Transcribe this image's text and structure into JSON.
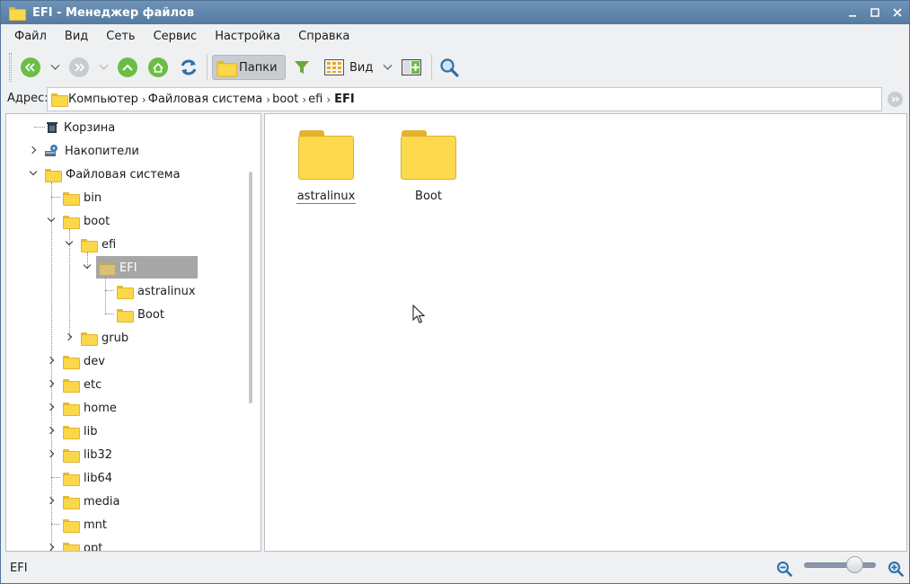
{
  "window": {
    "title": "EFI - Менеджер файлов",
    "minimize": "_",
    "maximize": "□",
    "close": "✕"
  },
  "menu": {
    "items": [
      "Файл",
      "Вид",
      "Сеть",
      "Сервис",
      "Настройка",
      "Справка"
    ]
  },
  "toolbar": {
    "folders_label": "Папки",
    "view_label": "Вид",
    "colors": {
      "nav_green": "#6cbd45",
      "refresh_blue": "#2f6ea6",
      "filter_green": "#6aa83a"
    }
  },
  "address": {
    "label": "Адрес:",
    "crumbs": [
      "Компьютер",
      "Файловая система",
      "boot",
      "efi"
    ],
    "current": "EFI"
  },
  "tree": {
    "items": [
      {
        "label": "Корзина",
        "icon": "trash-icon"
      },
      {
        "label": "Накопители",
        "icon": "drives-icon"
      },
      {
        "label": "Файловая система",
        "icon": "folder-icon"
      },
      {
        "label": "bin"
      },
      {
        "label": "boot"
      },
      {
        "label": "efi"
      },
      {
        "label": "EFI",
        "selected": true
      },
      {
        "label": "astralinux"
      },
      {
        "label": "Boot"
      },
      {
        "label": "grub"
      },
      {
        "label": "dev"
      },
      {
        "label": "etc"
      },
      {
        "label": "home"
      },
      {
        "label": "lib"
      },
      {
        "label": "lib32"
      },
      {
        "label": "lib64"
      },
      {
        "label": "media"
      },
      {
        "label": "mnt"
      },
      {
        "label": "opt"
      }
    ]
  },
  "content": {
    "items": [
      {
        "name": "astralinux",
        "focused": true
      },
      {
        "name": "Boot",
        "focused": false
      }
    ]
  },
  "status": {
    "text": "EFI",
    "zoom_fraction": 0.7
  }
}
